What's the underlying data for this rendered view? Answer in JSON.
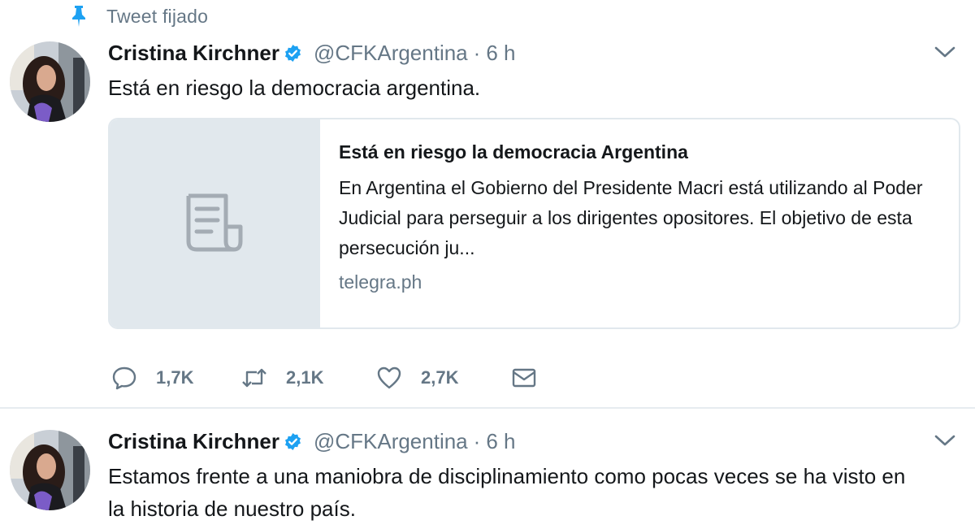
{
  "pinned": {
    "label": "Tweet fijado",
    "icon": "pin-icon"
  },
  "colors": {
    "verified": "#1da1f2",
    "secondary_text": "#657786",
    "card_media_bg": "#e1e8ed"
  },
  "tweets": [
    {
      "author": {
        "name": "Cristina Kirchner",
        "handle": "@CFKArgentina",
        "verified": true
      },
      "separator": "·",
      "time": "6 h",
      "text": "Está en riesgo la democracia argentina.",
      "card": {
        "title": "Está en riesgo la democracia Argentina",
        "description": "En Argentina el Gobierno del Presidente Macri está utilizando al Poder Judicial para perseguir a los dirigentes opositores. El objetivo de esta persecución ju...",
        "domain": "telegra.ph",
        "media_icon": "document-icon"
      },
      "actions": {
        "replies": "1,7K",
        "retweets": "2,1K",
        "likes": "2,7K"
      }
    },
    {
      "author": {
        "name": "Cristina Kirchner",
        "handle": "@CFKArgentina",
        "verified": true
      },
      "separator": "·",
      "time": "6 h",
      "text": "Estamos frente a una maniobra de disciplinamiento como pocas veces se ha visto en la historia de nuestro país."
    }
  ]
}
